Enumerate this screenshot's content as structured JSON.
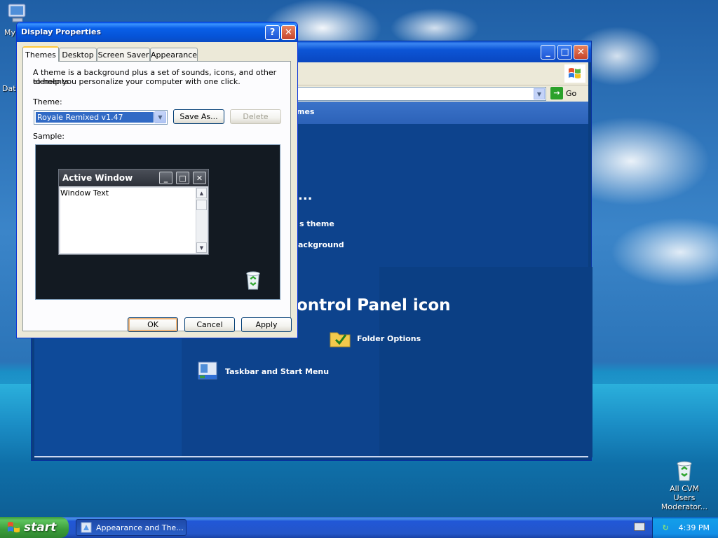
{
  "desktop": {
    "icons": [
      {
        "name": "my-computer",
        "label": "My"
      },
      {
        "name": "data",
        "label": "Dat"
      },
      {
        "name": "recycle-bin",
        "label": "All CVM Users Moderator..."
      }
    ]
  },
  "background_window": {
    "items": {
      "themes_header": "mes",
      "ellipsis": "...",
      "change_theme": "s theme",
      "change_background": "ackground",
      "pick_icon": "ontrol Panel icon",
      "folder_options": "Folder Options",
      "taskbar_start": "Taskbar and Start Menu"
    },
    "go_label": "Go"
  },
  "dialog": {
    "title": "Display Properties",
    "tabs": [
      {
        "label": "Themes",
        "active": true
      },
      {
        "label": "Desktop",
        "active": false
      },
      {
        "label": "Screen Saver",
        "active": false
      },
      {
        "label": "Appearance",
        "active": false
      }
    ],
    "description_line1": "A theme is a background plus a set of sounds, icons, and other elements",
    "description_line2": "to help you personalize your computer with one click.",
    "theme_label": "Theme:",
    "theme_value": "Royale Remixed v1.47",
    "save_as": "Save As...",
    "delete": "Delete",
    "sample_label": "Sample:",
    "preview": {
      "window_title": "Active Window",
      "window_text": "Window Text"
    },
    "ok": "OK",
    "cancel": "Cancel",
    "apply": "Apply"
  },
  "taskbar": {
    "start_label": "start",
    "task_button": "Appearance and The...",
    "clock": "4:39 PM"
  },
  "colors": {
    "title_blue": "#0554d8",
    "taskbar_blue": "#2456c8",
    "start_green": "#3a9c3a",
    "selection": "#316ac5"
  }
}
